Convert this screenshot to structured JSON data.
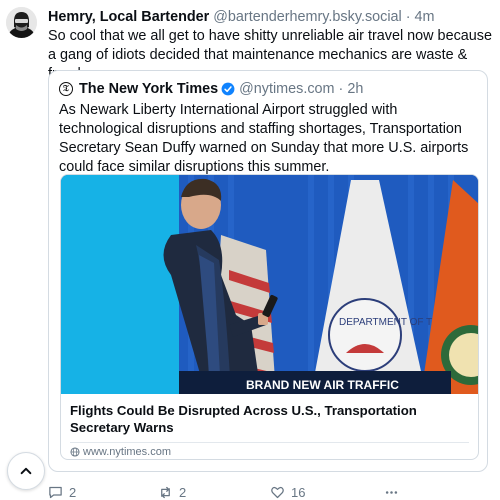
{
  "post": {
    "author_name": "Hemry, Local Bartender",
    "author_handle": "@bartenderhemry.bsky.social",
    "separator": "·",
    "time": "4m",
    "text": "So cool that we all get to have shitty unreliable air travel now because a gang of idiots decided that maintenance mechanics are waste & fraud",
    "avatar_icon": "avatar-image"
  },
  "quote": {
    "author_name": "The New York Times",
    "author_handle": "@nytimes.com",
    "separator": "·",
    "time": "2h",
    "verified_icon": "verified-check-icon",
    "verified_color": "#1083fe",
    "text": "As Newark Liberty International Airport struggled with technological disruptions and staffing shortages, Transportation Secretary Sean Duffy warned on Sunday that more U.S. airports could face similar disruptions this summer.",
    "embed": {
      "banner_text": "BRAND NEW AIR TRAFFIC",
      "seal_text": "DEPARTMENT OF TRA",
      "title": "Flights Could Be Disrupted Across U.S., Transportation Secretary Warns",
      "domain": "www.nytimes.com",
      "domain_icon": "globe-icon"
    }
  },
  "actions": {
    "reply_count": "2",
    "repost_count": "2",
    "like_count": "16"
  },
  "scroll_top_icon": "chevron-up-icon",
  "colors": {
    "text": "#0b0f14",
    "muted": "#687684",
    "border": "#d4dbe2",
    "accent": "#1083fe"
  }
}
